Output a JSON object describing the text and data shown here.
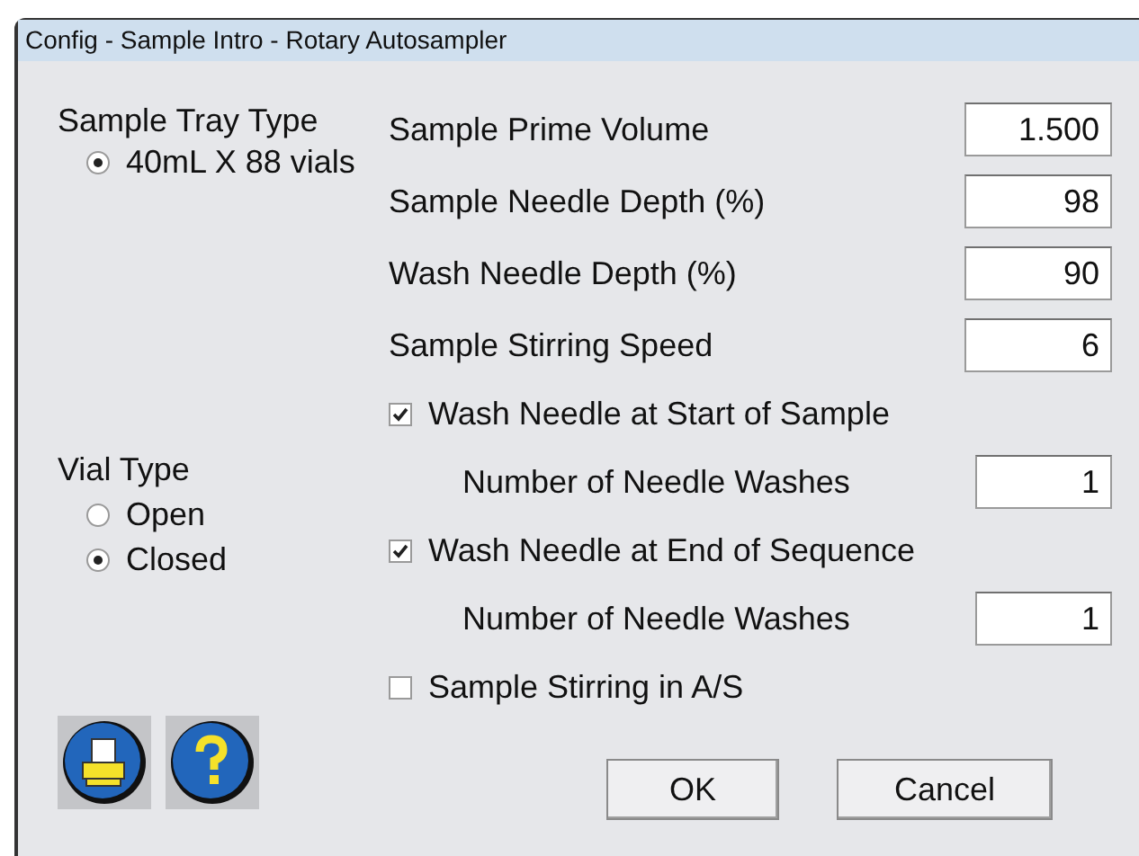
{
  "window": {
    "title": "Config - Sample Intro - Rotary Autosampler"
  },
  "tray_type": {
    "label": "Sample Tray Type",
    "options": [
      {
        "label": "40mL X 88 vials",
        "selected": true
      }
    ]
  },
  "vial_type": {
    "label": "Vial Type",
    "options": [
      {
        "label": "Open",
        "selected": false
      },
      {
        "label": "Closed",
        "selected": true
      }
    ]
  },
  "fields": [
    {
      "label": "Sample Prime Volume",
      "value": "1.500"
    },
    {
      "label": "Sample Needle Depth (%)",
      "value": "98"
    },
    {
      "label": "Wash Needle Depth (%)",
      "value": "90"
    },
    {
      "label": "Sample Stirring Speed",
      "value": "6"
    }
  ],
  "options": [
    {
      "label": "Wash Needle at Start of Sample",
      "checked": true,
      "sub": {
        "label": "Number of Needle Washes",
        "value": "1"
      }
    },
    {
      "label": "Wash Needle at End of Sequence",
      "checked": true,
      "sub": {
        "label": "Number of Needle Washes",
        "value": "1"
      }
    },
    {
      "label": "Sample Stirring in A/S",
      "checked": false
    }
  ],
  "buttons": [
    "OK",
    "Cancel"
  ]
}
